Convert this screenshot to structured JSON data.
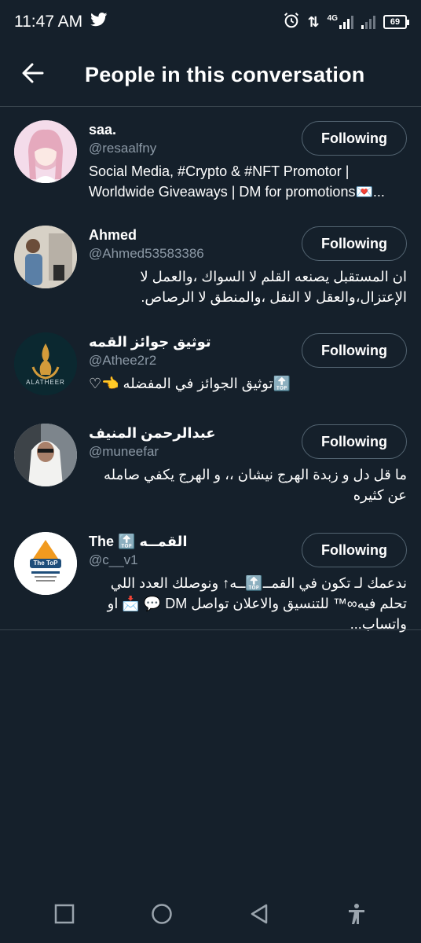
{
  "status_bar": {
    "time": "11:47 AM",
    "network": "4G",
    "battery": "69",
    "icons": [
      "twitter-icon",
      "alarm-icon",
      "data-arrows-icon",
      "signal-icon",
      "battery-icon"
    ]
  },
  "header": {
    "back_icon": "arrow-left-icon",
    "title": "People in this conversation"
  },
  "people": [
    {
      "name": "saa.",
      "handle": "@resaalfny",
      "bio": "Social Media, #Crypto & #NFT Promotor | Worldwide Giveaways | DM for promotions💌...",
      "bio_rtl": false,
      "button": "Following",
      "avatar_color": "#f2d6e6"
    },
    {
      "name": "Ahmed",
      "handle": "@Ahmed53583386",
      "bio": "ان المستقبل يصنعه القلم لا السواك ،والعمل لا الإعتزال،والعقل لا النقل ،والمنطق لا الرصاص.",
      "bio_rtl": true,
      "button": "Following",
      "avatar_color": "#c9c3b8"
    },
    {
      "name": "توثيق جوائز القمه",
      "handle": "@Athee2r2",
      "bio": "🔝توثيق الجوائز في المفضله 👈♡",
      "bio_rtl": true,
      "button": "Following",
      "avatar_color": "#0e2a33",
      "avatar_label": "ALATHEER"
    },
    {
      "name": "عبدالرحمن المنيف",
      "handle": "@muneefar",
      "bio": "ما قل دل و زبدة الهرج نيشان ،، و الهرج يكفي صامله عن كثيره",
      "bio_rtl": true,
      "button": "Following",
      "avatar_color": "#d9dde2"
    },
    {
      "name": "The 🔝 القمــه",
      "handle": "@c__v1",
      "bio": "ندعمك لـ تكون في القمــ🔝ــه↑ ونوصلك العدد اللي تحلم فيه∞™ للتنسيق والاعلان تواصل DM 💬 📩 او واتساب...",
      "bio_rtl": true,
      "button": "Following",
      "avatar_color": "#ffffff",
      "avatar_label": "The ToP"
    }
  ],
  "nav_bar": {
    "icons": [
      "recent-apps-icon",
      "home-icon",
      "back-icon",
      "accessibility-icon"
    ]
  }
}
